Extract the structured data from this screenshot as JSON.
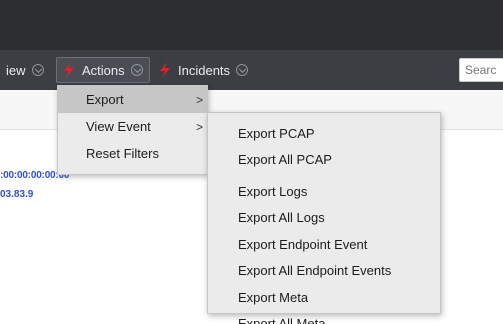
{
  "toolbar": {
    "view_label": "iew",
    "actions_label": "Actions",
    "incidents_label": "Incidents",
    "search_placeholder": "Searc"
  },
  "content": {
    "address_line1": ":00:00:00:00:00",
    "address_line2": "03.83.9"
  },
  "actions_menu": {
    "items": [
      {
        "label": "Export",
        "has_submenu": true,
        "selected": true
      },
      {
        "label": "View Event",
        "has_submenu": true,
        "selected": false
      },
      {
        "label": "Reset Filters",
        "has_submenu": false,
        "selected": false
      }
    ],
    "submenu_arrow": ">"
  },
  "export_submenu": {
    "items": [
      {
        "label": "Export PCAP"
      },
      {
        "label": "Export All PCAP"
      },
      {
        "label": "Export Logs"
      },
      {
        "label": "Export All Logs"
      },
      {
        "label": "Export Endpoint Event"
      },
      {
        "label": "Export All Endpoint Events"
      },
      {
        "label": "Export Meta"
      },
      {
        "label": "Export All Meta"
      }
    ]
  },
  "colors": {
    "accent_bolt": "#e0202a",
    "link_blue": "#2f4fd8",
    "toolbar_bg": "#3b3f44"
  },
  "icons": [
    "chevron-down-icon",
    "lightning-bolt-icon",
    "submenu-arrow-icon"
  ]
}
